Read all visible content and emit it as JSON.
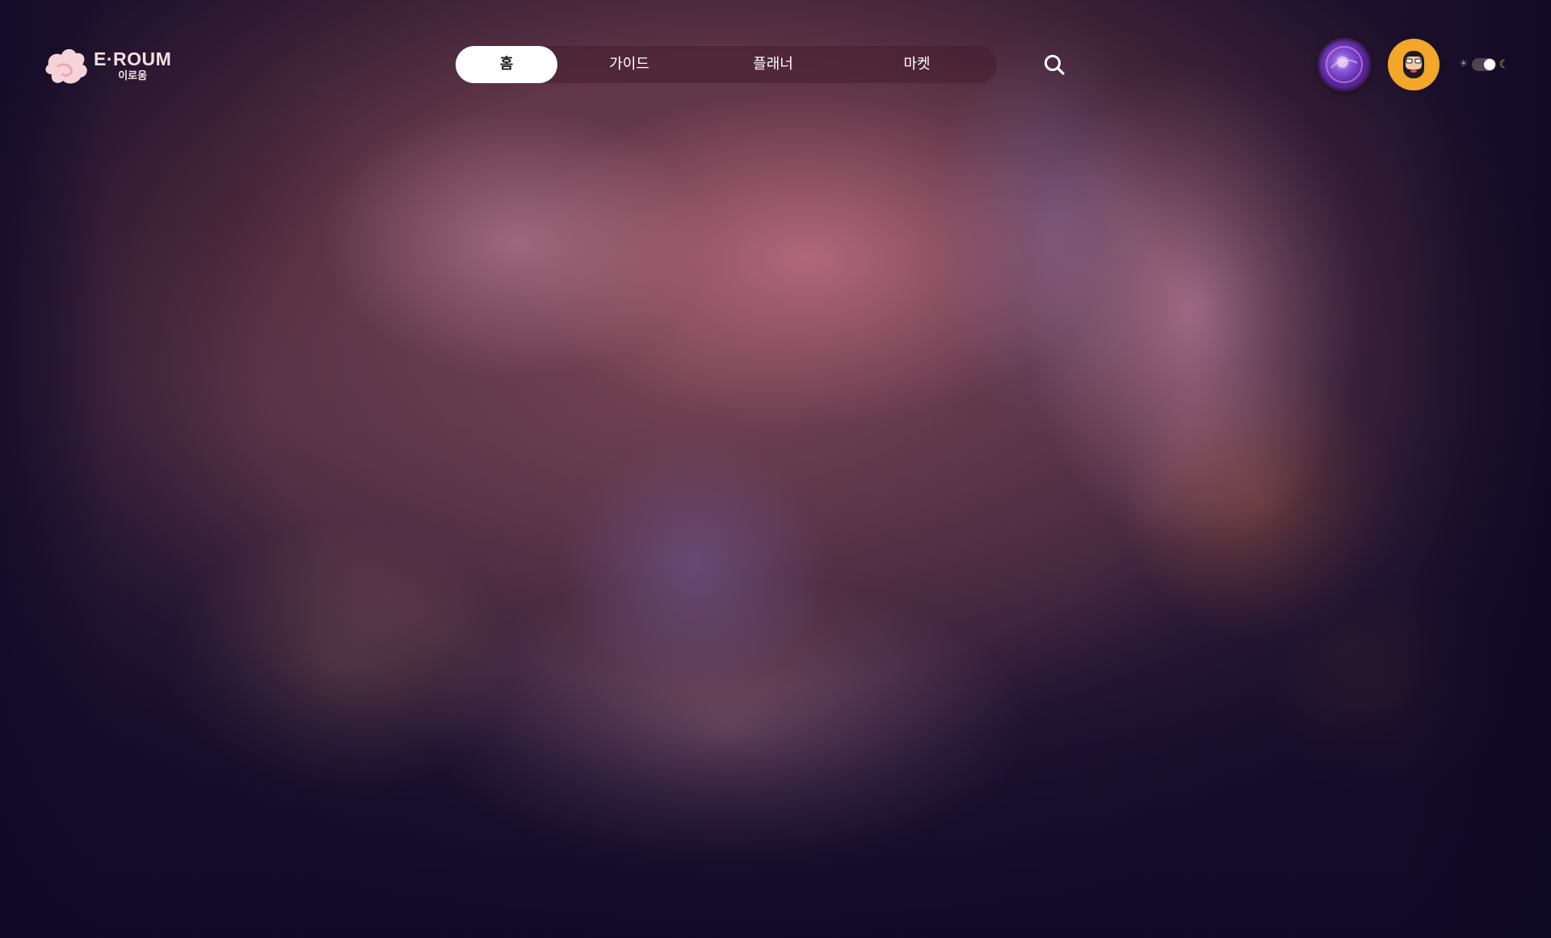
{
  "header": {
    "logo": {
      "title": "E·ROUM",
      "subtitle": "이로움"
    },
    "nav": {
      "items": [
        {
          "label": "홈",
          "active": true
        },
        {
          "label": "가이드",
          "active": false
        },
        {
          "label": "플래너",
          "active": false
        },
        {
          "label": "마켓",
          "active": false
        }
      ]
    },
    "search_icon": "search-icon",
    "avatars": [
      {
        "icon": "planet-orb-avatar"
      },
      {
        "icon": "bearded-man-avatar"
      }
    ],
    "theme_toggle": {
      "state": "dark",
      "sun_icon": "sun-icon",
      "moon_icon": "moon-icon"
    }
  },
  "colors": {
    "nav_active_bg": "#ffffff",
    "nav_bg": "#5a2a38",
    "logo_text": "#f3dede",
    "avatar_face_bg": "#f2a72a",
    "moon": "#f2b83a"
  }
}
